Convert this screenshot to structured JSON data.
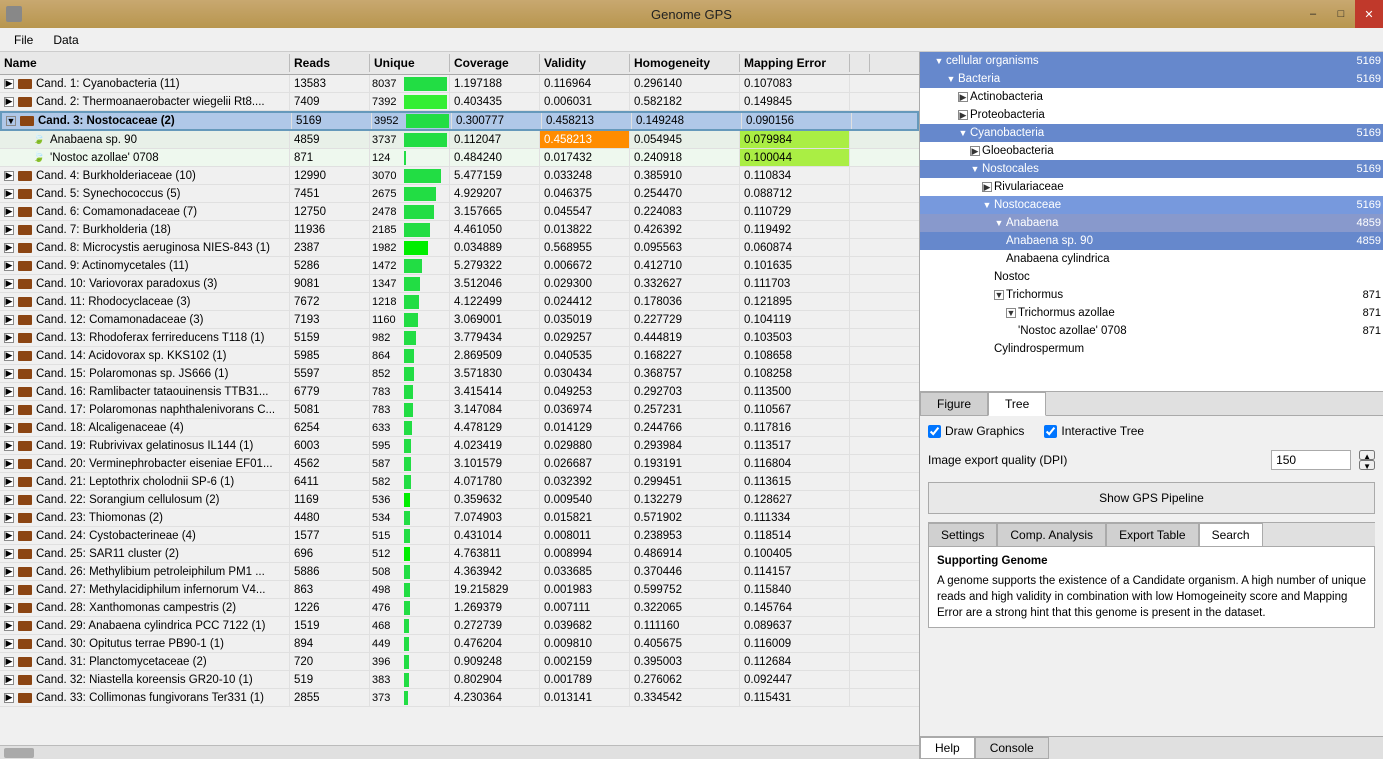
{
  "app": {
    "title": "Genome GPS",
    "window_controls": [
      "minimize",
      "maximize",
      "close"
    ]
  },
  "menu": {
    "items": [
      "File",
      "Data"
    ]
  },
  "table": {
    "columns": [
      "Name",
      "Reads",
      "Unique",
      "Coverage",
      "Validity",
      "Homogeneity",
      "Mapping Error"
    ],
    "rows": [
      {
        "name": "Cand. 1: Cyanobacteria (11)",
        "reads": "13583",
        "unique": "8037",
        "coverage": "1.197188",
        "validity": "0.116964",
        "homogeneity": "0.296140",
        "mapping_error": "0.107083",
        "indent": 0,
        "bar_pct": 95,
        "selected": false
      },
      {
        "name": "Cand. 2: Thermoanaerobacter wiegelii Rt8....",
        "reads": "7409",
        "unique": "7392",
        "coverage": "0.403435",
        "validity": "0.006031",
        "homogeneity": "0.582182",
        "mapping_error": "0.149845",
        "indent": 0,
        "bar_pct": 88,
        "selected": false
      },
      {
        "name": "Cand. 3: Nostocaceae (2)",
        "reads": "5169",
        "unique": "3952",
        "coverage": "0.300777",
        "validity": "0.458213",
        "homogeneity": "0.149248",
        "mapping_error": "0.090156",
        "indent": 0,
        "bar_pct": 47,
        "selected": true,
        "expanded": true
      },
      {
        "name": "Anabaena sp. 90",
        "reads": "4859",
        "unique": "3737",
        "coverage": "0.112047",
        "validity": "0.458213",
        "homogeneity": "0.054945",
        "mapping_error": "0.079984",
        "indent": 1,
        "bar_pct": 44,
        "selected": false,
        "validity_hi": true,
        "mapping_hi": true
      },
      {
        "name": "'Nostoc azollae' 0708",
        "reads": "871",
        "unique": "124",
        "coverage": "0.484240",
        "validity": "0.017432",
        "homogeneity": "0.240918",
        "mapping_error": "0.100044",
        "indent": 1,
        "bar_pct": 2,
        "selected": false,
        "mapping_hi2": true
      },
      {
        "name": "Cand. 4: Burkholderiaceae (10)",
        "reads": "12990",
        "unique": "3070",
        "coverage": "5.477159",
        "validity": "0.033248",
        "homogeneity": "0.385910",
        "mapping_error": "0.110834",
        "indent": 0,
        "bar_pct": 37
      },
      {
        "name": "Cand. 5: Synechococcus (5)",
        "reads": "7451",
        "unique": "2675",
        "coverage": "4.929207",
        "validity": "0.046375",
        "homogeneity": "0.254470",
        "mapping_error": "0.088712",
        "indent": 0,
        "bar_pct": 32
      },
      {
        "name": "Cand. 6: Comamonadaceae (7)",
        "reads": "12750",
        "unique": "2478",
        "coverage": "3.157665",
        "validity": "0.045547",
        "homogeneity": "0.224083",
        "mapping_error": "0.110729",
        "indent": 0,
        "bar_pct": 30
      },
      {
        "name": "Cand. 7: Burkholderia (18)",
        "reads": "11936",
        "unique": "2185",
        "coverage": "4.461050",
        "validity": "0.013822",
        "homogeneity": "0.426392",
        "mapping_error": "0.119492",
        "indent": 0,
        "bar_pct": 26
      },
      {
        "name": "Cand. 8: Microcystis aeruginosa NIES-843 (1)",
        "reads": "2387",
        "unique": "1982",
        "coverage": "0.034889",
        "validity": "0.568955",
        "homogeneity": "0.095563",
        "mapping_error": "0.060874",
        "indent": 0,
        "bar_pct": 24,
        "bar_green": true
      },
      {
        "name": "Cand. 9: Actinomycetales (11)",
        "reads": "5286",
        "unique": "1472",
        "coverage": "5.279322",
        "validity": "0.006672",
        "homogeneity": "0.412710",
        "mapping_error": "0.101635",
        "indent": 0,
        "bar_pct": 18
      },
      {
        "name": "Cand. 10: Variovorax paradoxus (3)",
        "reads": "9081",
        "unique": "1347",
        "coverage": "3.512046",
        "validity": "0.029300",
        "homogeneity": "0.332627",
        "mapping_error": "0.111703",
        "indent": 0,
        "bar_pct": 16
      },
      {
        "name": "Cand. 11: Rhodocyclaceae (3)",
        "reads": "7672",
        "unique": "1218",
        "coverage": "4.122499",
        "validity": "0.024412",
        "homogeneity": "0.178036",
        "mapping_error": "0.121895",
        "indent": 0,
        "bar_pct": 15
      },
      {
        "name": "Cand. 12: Comamonadaceae (3)",
        "reads": "7193",
        "unique": "1160",
        "coverage": "3.069001",
        "validity": "0.035019",
        "homogeneity": "0.227729",
        "mapping_error": "0.104119",
        "indent": 0,
        "bar_pct": 14
      },
      {
        "name": "Cand. 13: Rhodoferax ferrireducens T118 (1)",
        "reads": "5159",
        "unique": "982",
        "coverage": "3.779434",
        "validity": "0.029257",
        "homogeneity": "0.444819",
        "mapping_error": "0.103503",
        "indent": 0,
        "bar_pct": 12
      },
      {
        "name": "Cand. 14: Acidovorax sp. KKS102 (1)",
        "reads": "5985",
        "unique": "864",
        "coverage": "2.869509",
        "validity": "0.040535",
        "homogeneity": "0.168227",
        "mapping_error": "0.108658",
        "indent": 0,
        "bar_pct": 10
      },
      {
        "name": "Cand. 15: Polaromonas sp. JS666 (1)",
        "reads": "5597",
        "unique": "852",
        "coverage": "3.571830",
        "validity": "0.030434",
        "homogeneity": "0.368757",
        "mapping_error": "0.108258",
        "indent": 0,
        "bar_pct": 10
      },
      {
        "name": "Cand. 16: Ramlibacter tataouinensis TTB31...",
        "reads": "6779",
        "unique": "783",
        "coverage": "3.415414",
        "validity": "0.049253",
        "homogeneity": "0.292703",
        "mapping_error": "0.113500",
        "indent": 0,
        "bar_pct": 9
      },
      {
        "name": "Cand. 17: Polaromonas naphthalenivorans C...",
        "reads": "5081",
        "unique": "783",
        "coverage": "3.147084",
        "validity": "0.036974",
        "homogeneity": "0.257231",
        "mapping_error": "0.110567",
        "indent": 0,
        "bar_pct": 9
      },
      {
        "name": "Cand. 18: Alcaligenaceae (4)",
        "reads": "6254",
        "unique": "633",
        "coverage": "4.478129",
        "validity": "0.014129",
        "homogeneity": "0.244766",
        "mapping_error": "0.117816",
        "indent": 0,
        "bar_pct": 8
      },
      {
        "name": "Cand. 19: Rubrivivax gelatinosus IL144 (1)",
        "reads": "6003",
        "unique": "595",
        "coverage": "4.023419",
        "validity": "0.029880",
        "homogeneity": "0.293984",
        "mapping_error": "0.113517",
        "indent": 0,
        "bar_pct": 7
      },
      {
        "name": "Cand. 20: Verminephrobacter eiseniae EF01...",
        "reads": "4562",
        "unique": "587",
        "coverage": "3.101579",
        "validity": "0.026687",
        "homogeneity": "0.193191",
        "mapping_error": "0.116804",
        "indent": 0,
        "bar_pct": 7
      },
      {
        "name": "Cand. 21: Leptothrix cholodnii SP-6 (1)",
        "reads": "6411",
        "unique": "582",
        "coverage": "4.071780",
        "validity": "0.032392",
        "homogeneity": "0.299451",
        "mapping_error": "0.113615",
        "indent": 0,
        "bar_pct": 7
      },
      {
        "name": "Cand. 22: Sorangium cellulosum (2)",
        "reads": "1169",
        "unique": "536",
        "coverage": "0.359632",
        "validity": "0.009540",
        "homogeneity": "0.132279",
        "mapping_error": "0.128627",
        "indent": 0,
        "bar_pct": 6,
        "bar_bright": true
      },
      {
        "name": "Cand. 23: Thiomonas (2)",
        "reads": "4480",
        "unique": "534",
        "coverage": "7.074903",
        "validity": "0.015821",
        "homogeneity": "0.571902",
        "mapping_error": "0.111334",
        "indent": 0,
        "bar_pct": 6
      },
      {
        "name": "Cand. 24: Cystobacterineae (4)",
        "reads": "1577",
        "unique": "515",
        "coverage": "0.431014",
        "validity": "0.008011",
        "homogeneity": "0.238953",
        "mapping_error": "0.118514",
        "indent": 0,
        "bar_pct": 6
      },
      {
        "name": "Cand. 25: SAR11 cluster (2)",
        "reads": "696",
        "unique": "512",
        "coverage": "4.763811",
        "validity": "0.008994",
        "homogeneity": "0.486914",
        "mapping_error": "0.100405",
        "indent": 0,
        "bar_pct": 6,
        "bar_bright": true
      },
      {
        "name": "Cand. 26: Methylibium petroleiphilum PM1 ...",
        "reads": "5886",
        "unique": "508",
        "coverage": "4.363942",
        "validity": "0.033685",
        "homogeneity": "0.370446",
        "mapping_error": "0.114157",
        "indent": 0,
        "bar_pct": 6
      },
      {
        "name": "Cand. 27: Methylacidiphilum infernorum V4...",
        "reads": "863",
        "unique": "498",
        "coverage": "19.215829",
        "validity": "0.001983",
        "homogeneity": "0.599752",
        "mapping_error": "0.115840",
        "indent": 0,
        "bar_pct": 6
      },
      {
        "name": "Cand. 28: Xanthomonas campestris (2)",
        "reads": "1226",
        "unique": "476",
        "coverage": "1.269379",
        "validity": "0.007111",
        "homogeneity": "0.322065",
        "mapping_error": "0.145764",
        "indent": 0,
        "bar_pct": 6
      },
      {
        "name": "Cand. 29: Anabaena cylindrica PCC 7122 (1)",
        "reads": "1519",
        "unique": "468",
        "coverage": "0.272739",
        "validity": "0.039682",
        "homogeneity": "0.111160",
        "mapping_error": "0.089637",
        "indent": 0,
        "bar_pct": 5
      },
      {
        "name": "Cand. 30: Opitutus terrae PB90-1 (1)",
        "reads": "894",
        "unique": "449",
        "coverage": "0.476204",
        "validity": "0.009810",
        "homogeneity": "0.405675",
        "mapping_error": "0.116009",
        "indent": 0,
        "bar_pct": 5
      },
      {
        "name": "Cand. 31: Planctomycetaceae (2)",
        "reads": "720",
        "unique": "396",
        "coverage": "0.909248",
        "validity": "0.002159",
        "homogeneity": "0.395003",
        "mapping_error": "0.112684",
        "indent": 0,
        "bar_pct": 5
      },
      {
        "name": "Cand. 32: Niastella koreensis GR20-10 (1)",
        "reads": "519",
        "unique": "383",
        "coverage": "0.802904",
        "validity": "0.001789",
        "homogeneity": "0.276062",
        "mapping_error": "0.092447",
        "indent": 0,
        "bar_pct": 5
      },
      {
        "name": "Cand. 33: Collimonas fungivorans Ter331 (1)",
        "reads": "2855",
        "unique": "373",
        "coverage": "4.230364",
        "validity": "0.013141",
        "homogeneity": "0.334542",
        "mapping_error": "0.115431",
        "indent": 0,
        "bar_pct": 4
      }
    ]
  },
  "tree": {
    "nodes": [
      {
        "label": "cellular organisms",
        "count": "5169",
        "indent": 0,
        "expanded": true,
        "selected": true
      },
      {
        "label": "Bacteria",
        "count": "5169",
        "indent": 1,
        "expanded": true,
        "selected": true
      },
      {
        "label": "Actinobacteria",
        "count": "",
        "indent": 2,
        "expanded": false,
        "selected": false
      },
      {
        "label": "Proteobacteria",
        "count": "",
        "indent": 2,
        "expanded": false,
        "selected": false
      },
      {
        "label": "Cyanobacteria",
        "count": "5169",
        "indent": 2,
        "expanded": true,
        "selected": true
      },
      {
        "label": "Gloeobacteria",
        "count": "",
        "indent": 3,
        "expanded": false,
        "selected": false
      },
      {
        "label": "Nostocales",
        "count": "5169",
        "indent": 3,
        "expanded": true,
        "selected": true
      },
      {
        "label": "Rivulariaceae",
        "count": "",
        "indent": 4,
        "expanded": false,
        "selected": false
      },
      {
        "label": "Nostocaceae",
        "count": "5169",
        "indent": 4,
        "expanded": true,
        "selected": true,
        "highlighted": true
      },
      {
        "label": "Anabaena",
        "count": "4859",
        "indent": 5,
        "expanded": true,
        "selected": false,
        "highlighted": true
      },
      {
        "label": "Anabaena sp. 90",
        "count": "4859",
        "indent": 6,
        "expanded": false,
        "selected": true
      },
      {
        "label": "Anabaena cylindrica",
        "count": "",
        "indent": 6,
        "expanded": false,
        "selected": false
      },
      {
        "label": "Nostoc",
        "count": "",
        "indent": 5,
        "expanded": false,
        "selected": false
      },
      {
        "label": "Trichormus",
        "count": "871",
        "indent": 5,
        "expanded": true,
        "selected": false
      },
      {
        "label": "Trichormus azollae",
        "count": "871",
        "indent": 6,
        "expanded": false,
        "selected": false
      },
      {
        "label": "'Nostoc azollae' 0708",
        "count": "871",
        "indent": 7,
        "expanded": false,
        "selected": false
      },
      {
        "label": "Cylindrospermum",
        "count": "",
        "indent": 5,
        "expanded": false,
        "selected": false
      }
    ]
  },
  "tabs": {
    "figure": "Figure",
    "tree": "Tree",
    "active": "tree"
  },
  "settings": {
    "draw_graphics": true,
    "interactive_tree": true,
    "draw_graphics_label": "Draw Graphics",
    "interactive_tree_label": "Interactive Tree",
    "image_export_label": "Image export quality (DPI)",
    "image_export_value": "150",
    "show_gps_label": "Show GPS Pipeline"
  },
  "bottom_tabs": {
    "settings": "Settings",
    "comp_analysis": "Comp. Analysis",
    "export_table": "Export Table",
    "search": "Search",
    "active": "search"
  },
  "supporting": {
    "title": "Supporting Genome",
    "text": "A genome supports the existence of a Candidate organism. A high number of unique reads and high validity in combination with low Homogeineity score and Mapping Error are a strong hint that this genome is present in the dataset."
  },
  "app_bottom": {
    "help": "Help",
    "console": "Console"
  }
}
